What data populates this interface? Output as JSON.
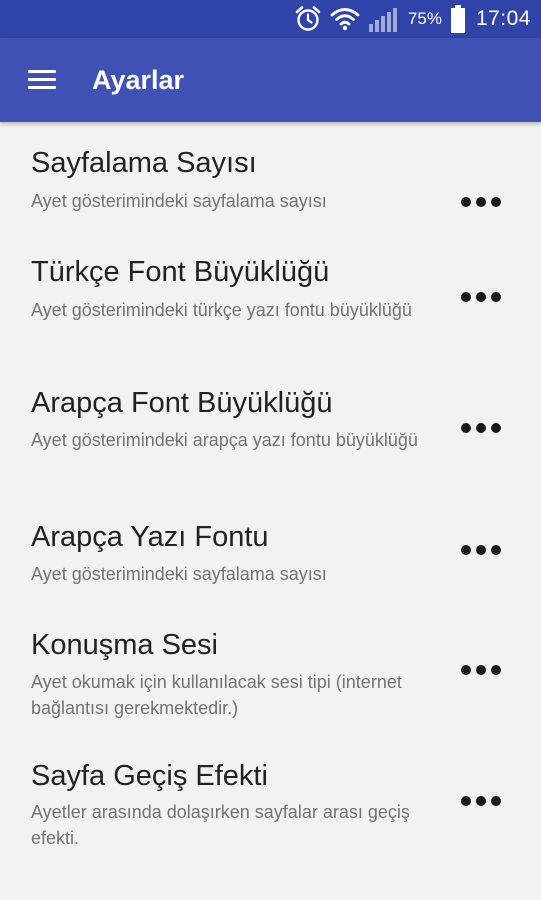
{
  "status_bar": {
    "battery_percent": "75%",
    "time": "17:04",
    "icons": [
      "alarm-icon",
      "wifi-icon",
      "signal-icon",
      "battery-icon"
    ]
  },
  "app_bar": {
    "title": "Ayarlar",
    "background_color": "#3f51b5",
    "status_color": "#2f43a8"
  },
  "settings": [
    {
      "title": "Sayfalama Sayısı",
      "description": "Ayet gösterimindeki sayfalama sayısı"
    },
    {
      "title": "Türkçe Font Büyüklüğü",
      "description": "Ayet gösterimindeki türkçe yazı fontu büyüklüğü"
    },
    {
      "title": "Arapça Font Büyüklüğü",
      "description": "Ayet gösterimindeki arapça yazı fontu büyüklüğü"
    },
    {
      "title": "Arapça Yazı Fontu",
      "description": "Ayet gösterimindeki sayfalama sayısı"
    },
    {
      "title": "Konuşma Sesi",
      "description": "Ayet okumak için kullanılacak sesi tipi (internet bağlantısı gerekmektedir.)"
    },
    {
      "title": "Sayfa Geçiş Efekti",
      "description": "Ayetler arasında dolaşırken sayfalar arası geçiş efekti."
    }
  ]
}
